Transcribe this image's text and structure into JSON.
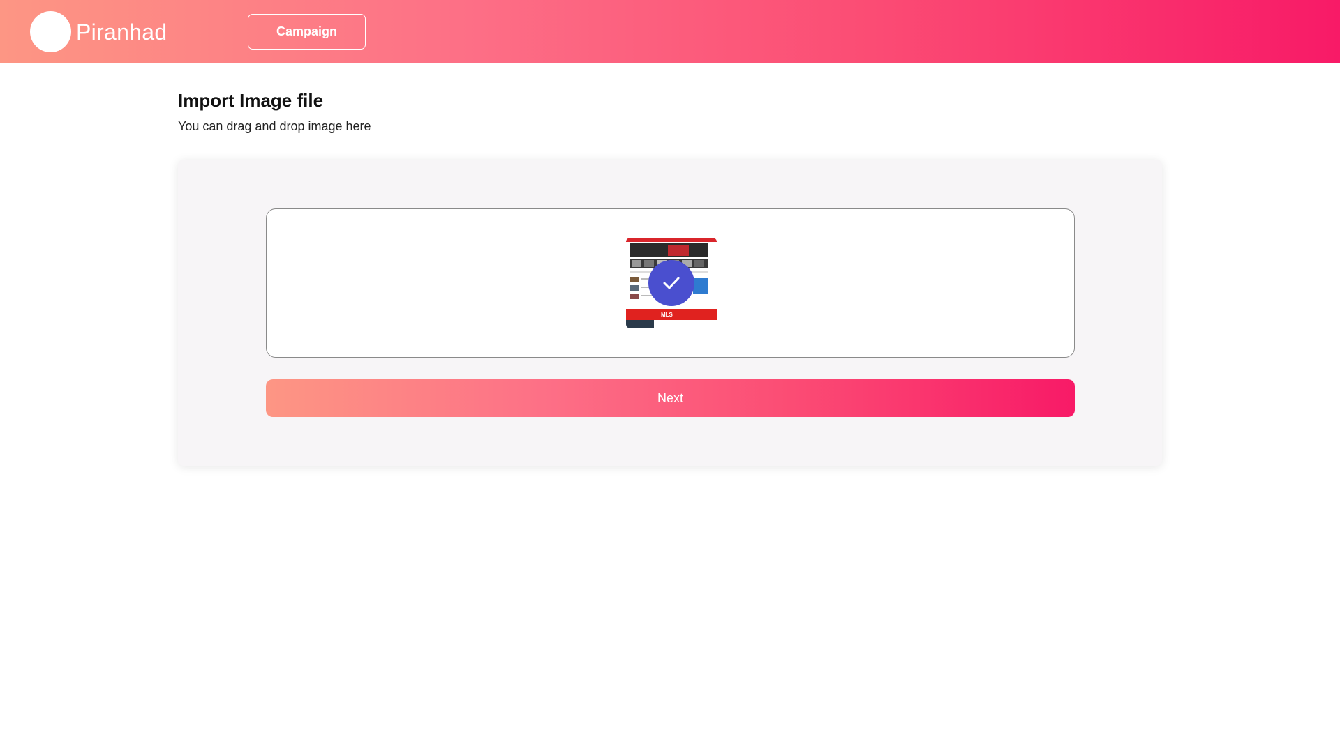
{
  "header": {
    "brand": "Piranhad",
    "campaign_label": "Campaign",
    "gradient": [
      "#fd9684",
      "#fd6f86",
      "#fb4c74",
      "#f81a67"
    ]
  },
  "main": {
    "title": "Import Image file",
    "subtitle": "You can drag and drop image here"
  },
  "dropzone": {
    "uploaded": true,
    "badge_icon": "check-icon",
    "badge_color": "#4a4fcf",
    "thumbnail_caption": "MLS"
  },
  "actions": {
    "next_label": "Next"
  }
}
